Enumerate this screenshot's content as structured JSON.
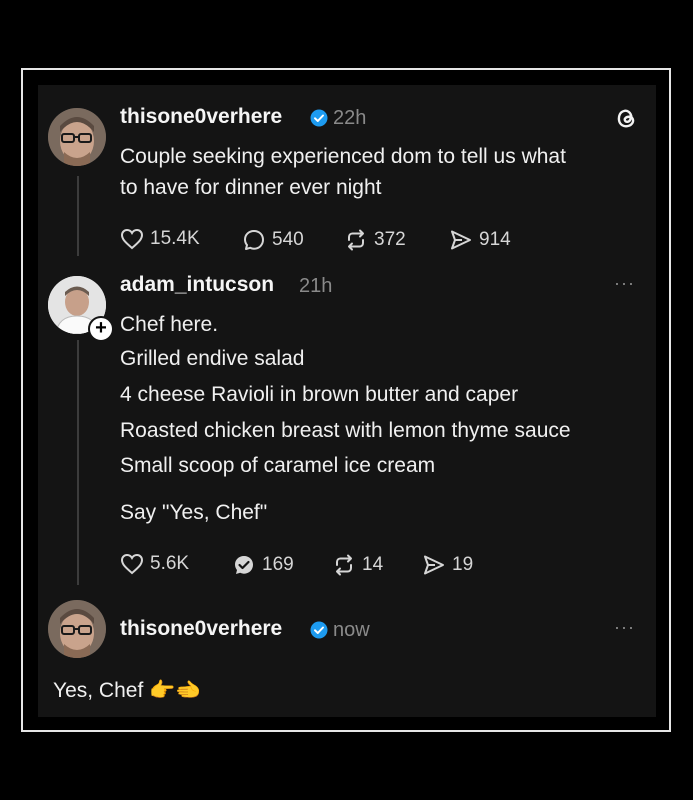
{
  "post1": {
    "username": "thisone0verhere",
    "time": "22h",
    "text_lines": [
      "Couple seeking experienced dom to tell us what",
      "to have for dinner ever night"
    ],
    "likes": "15.4K",
    "replies": "540",
    "reposts": "372",
    "shares": "914"
  },
  "post2": {
    "username": "adam_intucson",
    "time": "21h",
    "more": "···",
    "text_lines": [
      "Chef here.",
      "Grilled endive salad",
      "4 cheese Ravioli in brown butter and caper",
      "Roasted chicken breast with lemon thyme sauce",
      "Small scoop of caramel ice cream"
    ],
    "closing_line": "Say \"Yes, Chef\"",
    "likes": "5.6K",
    "replies": "169",
    "reposts": "14",
    "shares": "19"
  },
  "post3": {
    "username": "thisone0verhere",
    "time": "now",
    "more": "···",
    "text": "Yes, Chef",
    "emoji": "👉🫲"
  },
  "colors": {
    "background": "#000000",
    "panel": "#141414",
    "verified": "#1d9bf0",
    "muted": "#8a8a8a"
  },
  "icons": [
    "threads-logo-icon",
    "heart-icon",
    "reply-icon",
    "repost-icon",
    "share-icon",
    "verified-icon",
    "follow-plus-icon",
    "more-icon"
  ]
}
